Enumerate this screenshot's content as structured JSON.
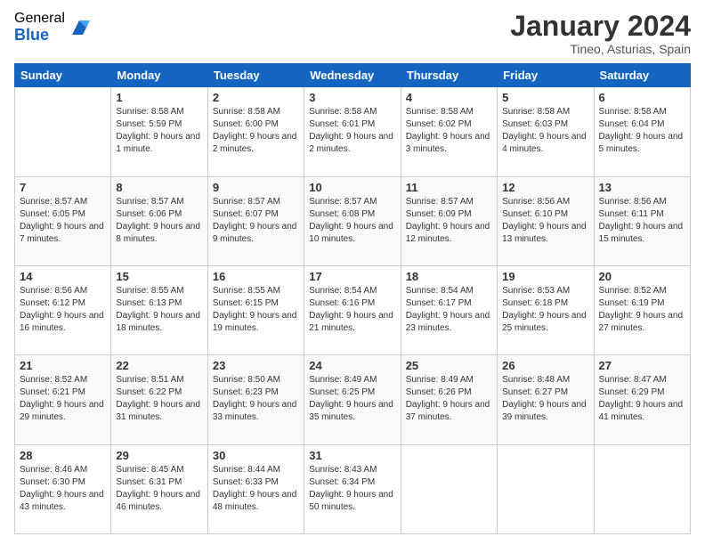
{
  "logo": {
    "general": "General",
    "blue": "Blue"
  },
  "title": "January 2024",
  "location": "Tineo, Asturias, Spain",
  "days_header": [
    "Sunday",
    "Monday",
    "Tuesday",
    "Wednesday",
    "Thursday",
    "Friday",
    "Saturday"
  ],
  "weeks": [
    [
      {
        "day": "",
        "sunrise": "",
        "sunset": "",
        "daylight": ""
      },
      {
        "day": "1",
        "sunrise": "Sunrise: 8:58 AM",
        "sunset": "Sunset: 5:59 PM",
        "daylight": "Daylight: 9 hours and 1 minute."
      },
      {
        "day": "2",
        "sunrise": "Sunrise: 8:58 AM",
        "sunset": "Sunset: 6:00 PM",
        "daylight": "Daylight: 9 hours and 2 minutes."
      },
      {
        "day": "3",
        "sunrise": "Sunrise: 8:58 AM",
        "sunset": "Sunset: 6:01 PM",
        "daylight": "Daylight: 9 hours and 2 minutes."
      },
      {
        "day": "4",
        "sunrise": "Sunrise: 8:58 AM",
        "sunset": "Sunset: 6:02 PM",
        "daylight": "Daylight: 9 hours and 3 minutes."
      },
      {
        "day": "5",
        "sunrise": "Sunrise: 8:58 AM",
        "sunset": "Sunset: 6:03 PM",
        "daylight": "Daylight: 9 hours and 4 minutes."
      },
      {
        "day": "6",
        "sunrise": "Sunrise: 8:58 AM",
        "sunset": "Sunset: 6:04 PM",
        "daylight": "Daylight: 9 hours and 5 minutes."
      }
    ],
    [
      {
        "day": "7",
        "sunrise": "Sunrise: 8:57 AM",
        "sunset": "Sunset: 6:05 PM",
        "daylight": "Daylight: 9 hours and 7 minutes."
      },
      {
        "day": "8",
        "sunrise": "Sunrise: 8:57 AM",
        "sunset": "Sunset: 6:06 PM",
        "daylight": "Daylight: 9 hours and 8 minutes."
      },
      {
        "day": "9",
        "sunrise": "Sunrise: 8:57 AM",
        "sunset": "Sunset: 6:07 PM",
        "daylight": "Daylight: 9 hours and 9 minutes."
      },
      {
        "day": "10",
        "sunrise": "Sunrise: 8:57 AM",
        "sunset": "Sunset: 6:08 PM",
        "daylight": "Daylight: 9 hours and 10 minutes."
      },
      {
        "day": "11",
        "sunrise": "Sunrise: 8:57 AM",
        "sunset": "Sunset: 6:09 PM",
        "daylight": "Daylight: 9 hours and 12 minutes."
      },
      {
        "day": "12",
        "sunrise": "Sunrise: 8:56 AM",
        "sunset": "Sunset: 6:10 PM",
        "daylight": "Daylight: 9 hours and 13 minutes."
      },
      {
        "day": "13",
        "sunrise": "Sunrise: 8:56 AM",
        "sunset": "Sunset: 6:11 PM",
        "daylight": "Daylight: 9 hours and 15 minutes."
      }
    ],
    [
      {
        "day": "14",
        "sunrise": "Sunrise: 8:56 AM",
        "sunset": "Sunset: 6:12 PM",
        "daylight": "Daylight: 9 hours and 16 minutes."
      },
      {
        "day": "15",
        "sunrise": "Sunrise: 8:55 AM",
        "sunset": "Sunset: 6:13 PM",
        "daylight": "Daylight: 9 hours and 18 minutes."
      },
      {
        "day": "16",
        "sunrise": "Sunrise: 8:55 AM",
        "sunset": "Sunset: 6:15 PM",
        "daylight": "Daylight: 9 hours and 19 minutes."
      },
      {
        "day": "17",
        "sunrise": "Sunrise: 8:54 AM",
        "sunset": "Sunset: 6:16 PM",
        "daylight": "Daylight: 9 hours and 21 minutes."
      },
      {
        "day": "18",
        "sunrise": "Sunrise: 8:54 AM",
        "sunset": "Sunset: 6:17 PM",
        "daylight": "Daylight: 9 hours and 23 minutes."
      },
      {
        "day": "19",
        "sunrise": "Sunrise: 8:53 AM",
        "sunset": "Sunset: 6:18 PM",
        "daylight": "Daylight: 9 hours and 25 minutes."
      },
      {
        "day": "20",
        "sunrise": "Sunrise: 8:52 AM",
        "sunset": "Sunset: 6:19 PM",
        "daylight": "Daylight: 9 hours and 27 minutes."
      }
    ],
    [
      {
        "day": "21",
        "sunrise": "Sunrise: 8:52 AM",
        "sunset": "Sunset: 6:21 PM",
        "daylight": "Daylight: 9 hours and 29 minutes."
      },
      {
        "day": "22",
        "sunrise": "Sunrise: 8:51 AM",
        "sunset": "Sunset: 6:22 PM",
        "daylight": "Daylight: 9 hours and 31 minutes."
      },
      {
        "day": "23",
        "sunrise": "Sunrise: 8:50 AM",
        "sunset": "Sunset: 6:23 PM",
        "daylight": "Daylight: 9 hours and 33 minutes."
      },
      {
        "day": "24",
        "sunrise": "Sunrise: 8:49 AM",
        "sunset": "Sunset: 6:25 PM",
        "daylight": "Daylight: 9 hours and 35 minutes."
      },
      {
        "day": "25",
        "sunrise": "Sunrise: 8:49 AM",
        "sunset": "Sunset: 6:26 PM",
        "daylight": "Daylight: 9 hours and 37 minutes."
      },
      {
        "day": "26",
        "sunrise": "Sunrise: 8:48 AM",
        "sunset": "Sunset: 6:27 PM",
        "daylight": "Daylight: 9 hours and 39 minutes."
      },
      {
        "day": "27",
        "sunrise": "Sunrise: 8:47 AM",
        "sunset": "Sunset: 6:29 PM",
        "daylight": "Daylight: 9 hours and 41 minutes."
      }
    ],
    [
      {
        "day": "28",
        "sunrise": "Sunrise: 8:46 AM",
        "sunset": "Sunset: 6:30 PM",
        "daylight": "Daylight: 9 hours and 43 minutes."
      },
      {
        "day": "29",
        "sunrise": "Sunrise: 8:45 AM",
        "sunset": "Sunset: 6:31 PM",
        "daylight": "Daylight: 9 hours and 46 minutes."
      },
      {
        "day": "30",
        "sunrise": "Sunrise: 8:44 AM",
        "sunset": "Sunset: 6:33 PM",
        "daylight": "Daylight: 9 hours and 48 minutes."
      },
      {
        "day": "31",
        "sunrise": "Sunrise: 8:43 AM",
        "sunset": "Sunset: 6:34 PM",
        "daylight": "Daylight: 9 hours and 50 minutes."
      },
      {
        "day": "",
        "sunrise": "",
        "sunset": "",
        "daylight": ""
      },
      {
        "day": "",
        "sunrise": "",
        "sunset": "",
        "daylight": ""
      },
      {
        "day": "",
        "sunrise": "",
        "sunset": "",
        "daylight": ""
      }
    ]
  ]
}
